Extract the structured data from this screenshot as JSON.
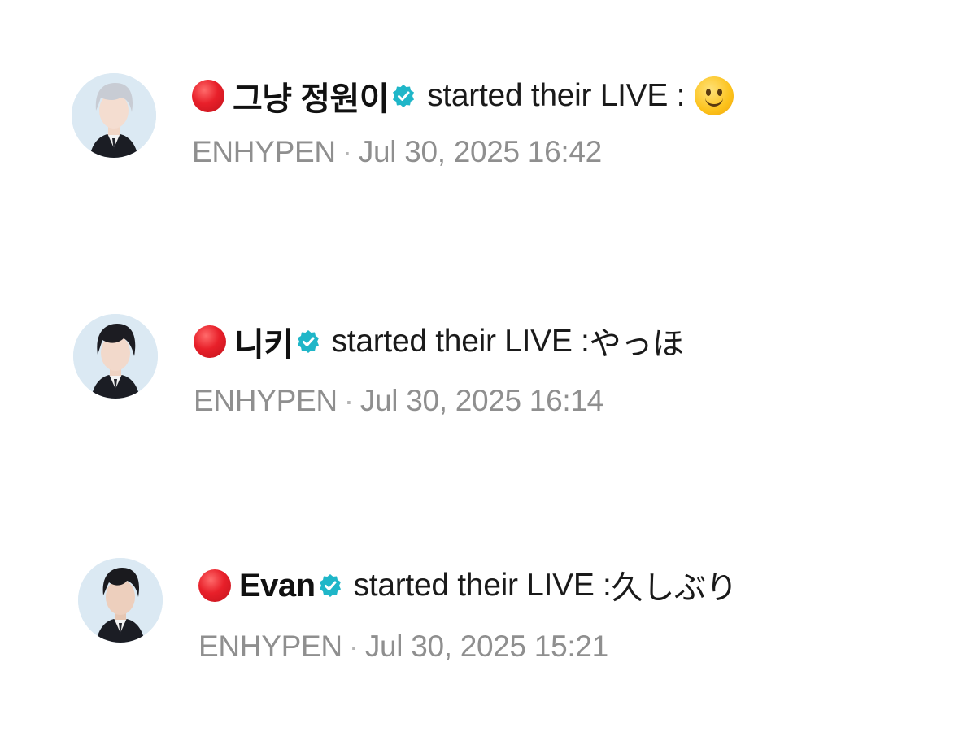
{
  "notifications": [
    {
      "username": "그냥 정원이",
      "message": "started their LIVE : ",
      "live_title": "",
      "live_title_emoji": "slightly-smiling-face-emoji",
      "artist": "ENHYPEN",
      "separator": "·",
      "timestamp": "Jul 30, 2025 16:42",
      "avatar_hair": "#c8ccd4"
    },
    {
      "username": "니키",
      "message": "started their LIVE : ",
      "live_title": "やっほ",
      "artist": "ENHYPEN",
      "separator": "·",
      "timestamp": "Jul 30, 2025 16:14",
      "avatar_hair": "#1c1c22"
    },
    {
      "username": "Evan",
      "message": "started their LIVE : ",
      "live_title": "久しぶり",
      "artist": "ENHYPEN",
      "separator": "·",
      "timestamp": "Jul 30, 2025 15:21",
      "avatar_hair": "#1a1a1e"
    }
  ],
  "colors": {
    "live_red": "#e8202a",
    "verified_teal": "#1fb6c8",
    "meta_gray": "#8f8f8f",
    "avatar_bg": "#dbe9f3"
  },
  "icons": {
    "live": "live-dot-icon",
    "verified": "verified-badge-icon"
  }
}
